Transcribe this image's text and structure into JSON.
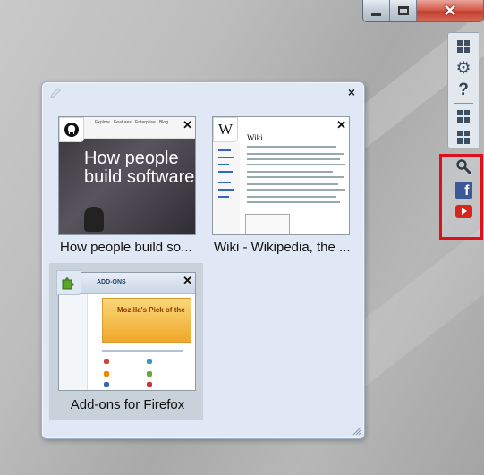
{
  "window": {
    "controls": {
      "minimize": "minimize",
      "maximize": "maximize",
      "close": "close"
    }
  },
  "toolbar": {
    "items": [
      "grid-view",
      "settings",
      "help",
      "thumbnails",
      "layout"
    ],
    "help_label": "?"
  },
  "social": {
    "items": [
      "search",
      "facebook",
      "youtube"
    ],
    "facebook_label": "f",
    "highlight_color": "#e0101a"
  },
  "panel": {
    "close_label": "×",
    "tiles": [
      {
        "title": "How people build so...",
        "thumb_heading": "How people build software",
        "icon": "github-icon"
      },
      {
        "title": "Wiki - Wikipedia, the ...",
        "thumb_heading": "Wiki",
        "icon": "wikipedia-icon"
      },
      {
        "title": "Add-ons for Firefox",
        "thumb_heading": "ADD-ONS",
        "banner": "Mozilla's Pick of the",
        "icon": "puzzle-icon",
        "selected": true
      }
    ]
  },
  "colors": {
    "panel_bg": "#dfe8f4",
    "close_red": "#c0402f",
    "selected_tile": "#c9d1db"
  }
}
